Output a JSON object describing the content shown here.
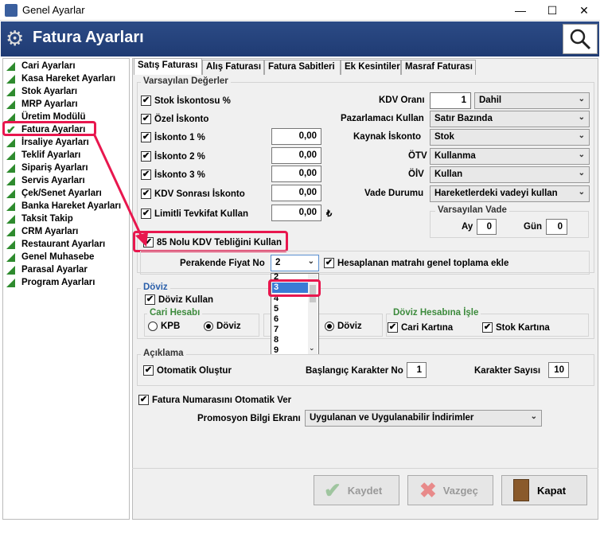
{
  "window": {
    "title": "Genel Ayarlar",
    "minimize": "—",
    "maximize": "☐",
    "close": "✕"
  },
  "header": {
    "title": "Fatura Ayarları"
  },
  "sidebar": {
    "items": [
      {
        "label": "Cari Ayarları"
      },
      {
        "label": "Kasa Hareket Ayarları"
      },
      {
        "label": "Stok Ayarları"
      },
      {
        "label": "MRP Ayarları"
      },
      {
        "label": "Üretim Modülü"
      },
      {
        "label": "Fatura Ayarları"
      },
      {
        "label": "İrsaliye Ayarları"
      },
      {
        "label": "Teklif Ayarları"
      },
      {
        "label": "Sipariş Ayarları"
      },
      {
        "label": "Servis Ayarları"
      },
      {
        "label": "Çek/Senet Ayarları"
      },
      {
        "label": "Banka Hareket Ayarları"
      },
      {
        "label": "Taksit Takip"
      },
      {
        "label": "CRM Ayarları"
      },
      {
        "label": "Restaurant Ayarları"
      },
      {
        "label": "Genel Muhasebe"
      },
      {
        "label": "Parasal Ayarlar"
      },
      {
        "label": "Program Ayarları"
      }
    ]
  },
  "tabs": [
    "Satış Faturası",
    "Alış Faturası",
    "Fatura Sabitleri",
    "Ek Kesintiler",
    "Masraf Faturası"
  ],
  "varsayilan": {
    "title": "Varsayılan Değerler",
    "stok_iskontosu": "Stok İskontosu %",
    "ozel_iskonto": "Özel İskonto",
    "iskonto1": "İskonto 1 %",
    "iskonto1_val": "0,00",
    "iskonto2": "İskonto 2 %",
    "iskonto2_val": "0,00",
    "iskonto3": "İskonto 3 %",
    "iskonto3_val": "0,00",
    "kdv_sonrasi": "KDV Sonrası İskonto",
    "kdv_sonrasi_val": "0,00",
    "limitli": "Limitli Tevkifat Kullan",
    "limitli_val": "0,00",
    "lira": "₺",
    "kdv_orani": "KDV Oranı",
    "kdv_orani_val": "1",
    "kdv_select": "Dahil",
    "pazarlamaci": "Pazarlamacı Kullan",
    "pazarlamaci_val": "Satır Bazında",
    "kaynak": "Kaynak İskonto",
    "kaynak_val": "Stok",
    "otv": "ÖTV",
    "otv_val": "Kullanma",
    "oiv": "ÖİV",
    "oiv_val": "Kullan",
    "vade_durumu": "Vade Durumu",
    "vade_val": "Hareketlerdeki vadeyi kullan",
    "vade_group": "Varsayılan Vade",
    "ay": "Ay",
    "ay_val": "0",
    "gun": "Gün",
    "gun_val": "0",
    "kdv85": "85 Nolu KDV Tebliğini Kullan"
  },
  "perakende": {
    "label": "Perakende Fiyat No",
    "value": "2",
    "matrah": "Hesaplanan matrahı genel toplama ekle"
  },
  "dropdown": {
    "items": [
      "2",
      "3",
      "4",
      "5",
      "6",
      "7",
      "8",
      "9"
    ]
  },
  "doviz": {
    "title": "Döviz",
    "kullan": "Döviz Kullan",
    "cari": "Cari Hesabı",
    "kpb": "KPB",
    "doviz": "Döviz",
    "doviz2": "Döviz",
    "isle": "Döviz Hesabına İşle",
    "cari_kart": "Cari Kartına",
    "stok_kart": "Stok Kartına"
  },
  "aciklama": {
    "title": "Açıklama",
    "otomatik": "Otomatik Oluştur",
    "baslangic": "Başlangıç Karakter No",
    "baslangic_val": "1",
    "sayisi": "Karakter Sayısı",
    "sayisi_val": "10"
  },
  "fatura_no": "Fatura Numarasını Otomatik Ver",
  "promosyon": {
    "label": "Promosyon Bilgi Ekranı",
    "value": "Uygulanan ve Uygulanabilir İndirimler"
  },
  "buttons": {
    "kaydet": "Kaydet",
    "vazgec": "Vazgeç",
    "kapat": "Kapat"
  },
  "colors": {
    "header": "#24427d",
    "highlight": "#e8174e",
    "check_green": "#2e8b2e"
  }
}
